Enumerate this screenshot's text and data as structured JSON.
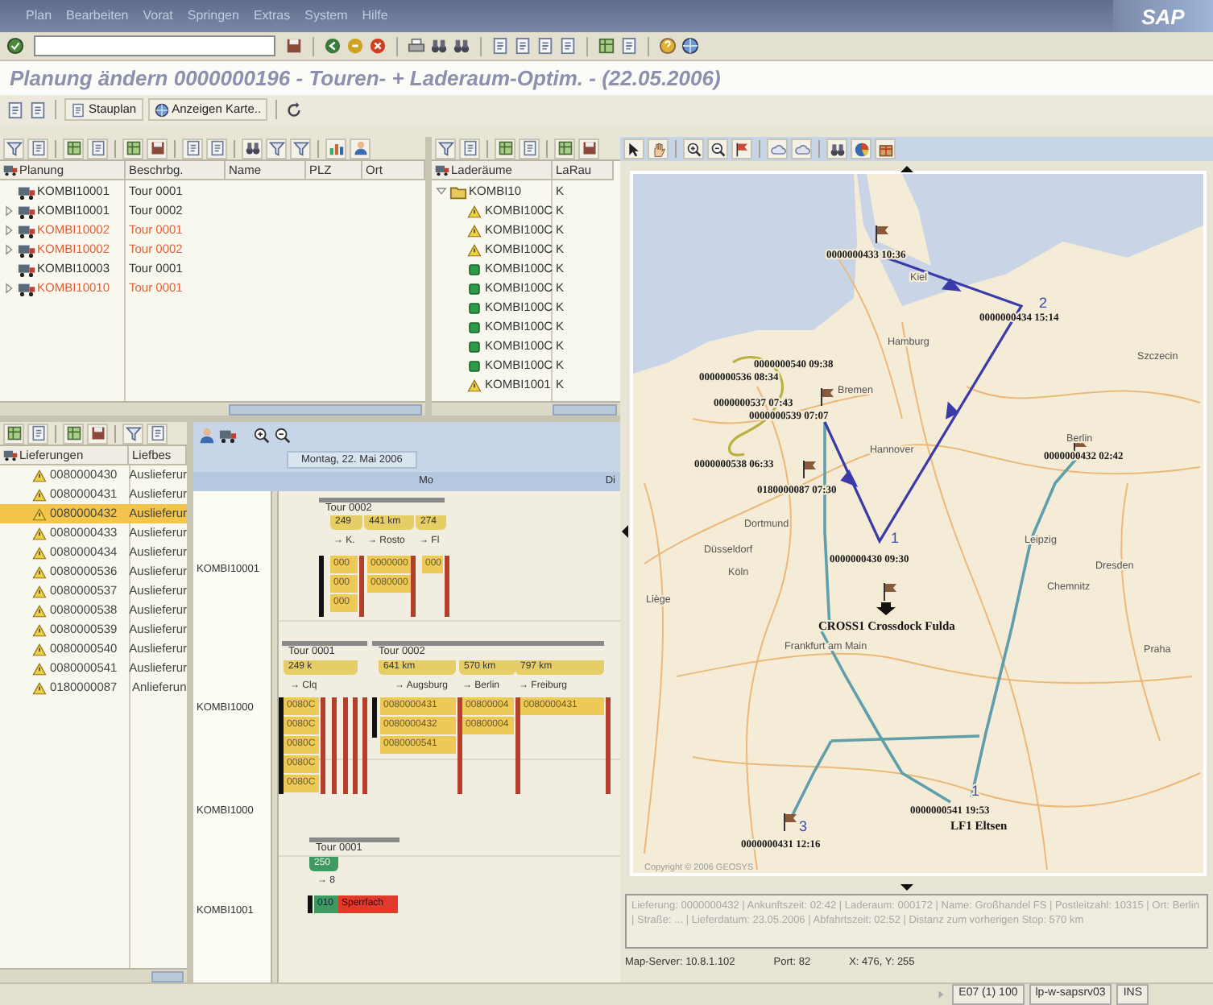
{
  "menu": [
    "Plan",
    "Bearbeiten",
    "Vorat",
    "Springen",
    "Extras",
    "System",
    "Hilfe"
  ],
  "logo": "SAP",
  "title": "Planung ändern 0000000196 - Touren- + Laderaum-Optim. - (22.05.2006)",
  "app_toolbar": [
    "Stauplan",
    "Anzeigen Karte.."
  ],
  "planning": {
    "columns": [
      "Planung",
      "Beschrbg.",
      "Name",
      "PLZ",
      "Ort"
    ],
    "rows": [
      {
        "id": "KOMBI10001",
        "desc": "Tour 0001",
        "expandable": false,
        "critical": false
      },
      {
        "id": "KOMBI10001",
        "desc": "Tour 0002",
        "expandable": true,
        "critical": false
      },
      {
        "id": "KOMBI10002",
        "desc": "Tour 0001",
        "expandable": true,
        "critical": true
      },
      {
        "id": "KOMBI10002",
        "desc": "Tour 0002",
        "expandable": true,
        "critical": true
      },
      {
        "id": "KOMBI10003",
        "desc": "Tour 0001",
        "expandable": false,
        "critical": false
      },
      {
        "id": "KOMBI10010",
        "desc": "Tour 0001",
        "expandable": true,
        "critical": true
      }
    ]
  },
  "load_spaces": {
    "columns": [
      "Laderäume",
      "LaRau"
    ],
    "root": {
      "label": "KOMBI10",
      "col2": "K",
      "expanded": true,
      "children": [
        {
          "label": "KOMBI100C",
          "col2": "K",
          "kind": "warning"
        },
        {
          "label": "KOMBI100C",
          "col2": "K",
          "kind": "warning"
        },
        {
          "label": "KOMBI100C",
          "col2": "K",
          "kind": "warning"
        },
        {
          "label": "KOMBI100C",
          "col2": "K",
          "kind": "ok"
        },
        {
          "label": "KOMBI100C",
          "col2": "K",
          "kind": "ok"
        },
        {
          "label": "KOMBI100C",
          "col2": "K",
          "kind": "ok"
        },
        {
          "label": "KOMBI100C",
          "col2": "K",
          "kind": "ok"
        },
        {
          "label": "KOMBI100C",
          "col2": "K",
          "kind": "ok"
        },
        {
          "label": "KOMBI100C",
          "col2": "K",
          "kind": "ok"
        },
        {
          "label": "KOMBI1001",
          "col2": "K",
          "kind": "warning"
        }
      ]
    }
  },
  "deliveries": {
    "columns": [
      "Lieferungen",
      "Liefbes"
    ],
    "rows": [
      {
        "id": "0080000430",
        "type": "Auslieferur",
        "selected": false
      },
      {
        "id": "0080000431",
        "type": "Auslieferur",
        "selected": false
      },
      {
        "id": "0080000432",
        "type": "Auslieferur",
        "selected": true
      },
      {
        "id": "0080000433",
        "type": "Auslieferur",
        "selected": false
      },
      {
        "id": "0080000434",
        "type": "Auslieferur",
        "selected": false
      },
      {
        "id": "0080000536",
        "type": "Auslieferur",
        "selected": false
      },
      {
        "id": "0080000537",
        "type": "Auslieferur",
        "selected": false
      },
      {
        "id": "0080000538",
        "type": "Auslieferur",
        "selected": false
      },
      {
        "id": "0080000539",
        "type": "Auslieferur",
        "selected": false
      },
      {
        "id": "0080000540",
        "type": "Auslieferur",
        "selected": false
      },
      {
        "id": "0080000541",
        "type": "Auslieferur",
        "selected": false
      },
      {
        "id": "0180000087",
        "type": "Anlieferun",
        "selected": false
      }
    ]
  },
  "gantt": {
    "date": "Montag, 22. Mai 2006",
    "days": [
      "Mo",
      "Di"
    ],
    "rows": [
      {
        "resource": "KOMBI10001",
        "tours": [
          "Tour 0002"
        ],
        "legs": [
          {
            "distance": "249",
            "destination": "→ K.",
            "kind": "loaded"
          },
          {
            "distance": "441 km",
            "destination": "→ Rosto",
            "kind": "loaded"
          },
          {
            "distance": "274",
            "destination": "→ Fl",
            "kind": "loaded"
          }
        ],
        "deliveries": [
          {
            "label": "000",
            "kind": "planned"
          },
          {
            "label": "0000000",
            "kind": "planned"
          },
          {
            "label": "000",
            "kind": "planned"
          },
          {
            "label": "000",
            "kind": "planned"
          },
          {
            "label": "0080000",
            "kind": "planned"
          },
          {
            "label": "000",
            "kind": "planned"
          }
        ]
      },
      {
        "resource": "KOMBI1000",
        "tours": [
          "Tour 0001",
          "Tour 0002"
        ],
        "legs": [
          {
            "distance": "249 k",
            "destination": "→ Clq",
            "kind": "loaded"
          },
          {
            "distance": "641 km",
            "destination": "→ Augsburg",
            "kind": "loaded"
          },
          {
            "distance": "570 km",
            "destination": "→ Berlin",
            "kind": "loaded"
          },
          {
            "distance": "797 km",
            "destination": "→ Freiburg",
            "kind": "loaded"
          }
        ],
        "deliveries": [
          {
            "label": "0080C",
            "kind": "planned"
          },
          {
            "label": "0080C",
            "kind": "planned"
          },
          {
            "label": "0080C",
            "kind": "planned"
          },
          {
            "label": "0080C",
            "kind": "planned"
          },
          {
            "label": "0080C",
            "kind": "planned"
          },
          {
            "label": "0080000431",
            "kind": "planned"
          },
          {
            "label": "0080000432",
            "kind": "planned"
          },
          {
            "label": "0080000541",
            "kind": "planned"
          },
          {
            "label": "00800004",
            "kind": "planned"
          },
          {
            "label": "00800004",
            "kind": "planned"
          },
          {
            "label": "0080000431",
            "kind": "planned"
          }
        ]
      },
      {
        "resource": "KOMBI1000"
      },
      {
        "resource": "KOMBI1001",
        "tours": [
          "Tour 0001"
        ],
        "legs": [
          {
            "distance": "250",
            "destination": "→ 8",
            "kind": "empty"
          }
        ],
        "deliveries": [
          {
            "label": "010",
            "kind": "loaded"
          },
          {
            "label": "Sperrfach",
            "kind": "blocked"
          }
        ]
      }
    ]
  },
  "map": {
    "labels": [
      {
        "text": "0000000433 10:36",
        "kind": "stop"
      },
      {
        "text": "Kiel",
        "kind": "city"
      },
      {
        "text": "0000000434 15:14",
        "kind": "stop"
      },
      {
        "text": "2",
        "kind": "sequence"
      },
      {
        "text": "Hamburg",
        "kind": "city"
      },
      {
        "text": "Szczecin",
        "kind": "city"
      },
      {
        "text": "0000000540 09:38",
        "kind": "stop"
      },
      {
        "text": "0000000536 08:34",
        "kind": "stop"
      },
      {
        "text": "Bremen",
        "kind": "city"
      },
      {
        "text": "0000000537 07:43",
        "kind": "stop"
      },
      {
        "text": "0000000539 07:07",
        "kind": "stop"
      },
      {
        "text": "Hannover",
        "kind": "city"
      },
      {
        "text": "Berlin",
        "kind": "city"
      },
      {
        "text": "0000000432 02:42",
        "kind": "stop"
      },
      {
        "text": "0000000538 06:33",
        "kind": "stop"
      },
      {
        "text": "0180000087 07:30",
        "kind": "stop"
      },
      {
        "text": "Dortmund",
        "kind": "city"
      },
      {
        "text": "Düsseldorf",
        "kind": "city"
      },
      {
        "text": "Köln",
        "kind": "city"
      },
      {
        "text": "1",
        "kind": "sequence"
      },
      {
        "text": "0000000430 09:30",
        "kind": "stop"
      },
      {
        "text": "Leipzig",
        "kind": "city"
      },
      {
        "text": "Dresden",
        "kind": "city"
      },
      {
        "text": "Chemnitz",
        "kind": "city"
      },
      {
        "text": "Liège",
        "kind": "city"
      },
      {
        "text": "CROSS1 Crossdock Fulda",
        "kind": "depot"
      },
      {
        "text": "Frankfurt am Main",
        "kind": "city"
      },
      {
        "text": "Praha",
        "kind": "city"
      },
      {
        "text": "1",
        "kind": "sequence"
      },
      {
        "text": "0000000541 19:53",
        "kind": "stop"
      },
      {
        "text": "LF1 Eltsen",
        "kind": "depot"
      },
      {
        "text": "3",
        "kind": "sequence"
      },
      {
        "text": "0000000431 12:16",
        "kind": "stop"
      }
    ],
    "copyright": "Copyright © 2006 GEOSYS",
    "info_text": "Lieferung: 0000000432 | Ankunftszeit: 02:42 | Laderaum: 000172 | Name: Großhandel FS | Postleitzahl: 10315 | Ort: Berlin | Straße: ... | Lieferdatum: 23.05.2006 | Abfahrtszeit: 02:52 | Distanz zum vorherigen Stop: 570 km",
    "server": "Map-Server: 10.8.1.102",
    "port": "Port: 82",
    "coords": "X: 476, Y: 255"
  },
  "status_bar": [
    "E07 (1) 100",
    "lp-w-sapsrv03",
    "INS"
  ]
}
